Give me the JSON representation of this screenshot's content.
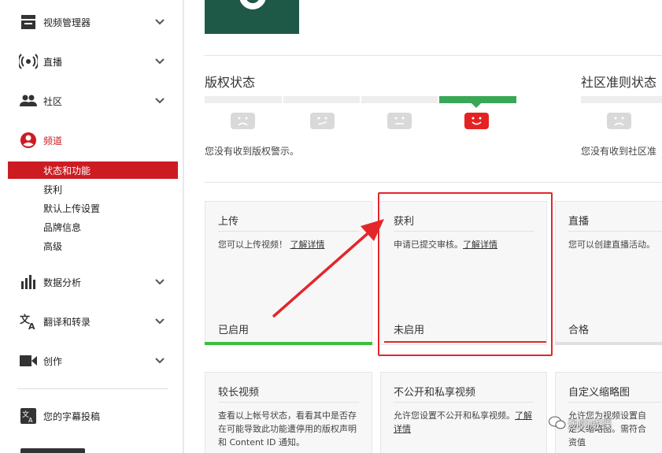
{
  "sidebar": {
    "items": [
      {
        "label": "视频管理器",
        "icon": "video-manager-icon"
      },
      {
        "label": "直播",
        "icon": "live-icon"
      },
      {
        "label": "社区",
        "icon": "community-icon"
      },
      {
        "label": "频道",
        "icon": "channel-icon"
      },
      {
        "label": "数据分析",
        "icon": "analytics-icon"
      },
      {
        "label": "翻译和转录",
        "icon": "translate-icon"
      },
      {
        "label": "创作",
        "icon": "create-icon"
      }
    ],
    "channel_subitems": [
      "状态和功能",
      "获利",
      "默认上传设置",
      "品牌信息",
      "高级"
    ],
    "active_subitem": "状态和功能",
    "subtitles": {
      "label": "您的字幕投稿",
      "icon": "subtitles-icon"
    }
  },
  "copyright": {
    "title": "版权状态",
    "text": "您没有收到版权警示。",
    "level": 4,
    "levels_total": 4
  },
  "community": {
    "title": "社区准则状态",
    "text": "您没有收到社区准"
  },
  "cards_row1": [
    {
      "title": "上传",
      "desc": "您可以上传视频！",
      "link": "了解详情",
      "status": "已启用",
      "bar": "green"
    },
    {
      "title": "获利",
      "desc": "申请已提交审核。",
      "link": "了解详情",
      "status": "未启用",
      "bar": "red"
    },
    {
      "title": "直播",
      "desc": "您可以创建直播活动。",
      "link": "",
      "status": "合格",
      "bar": "gray"
    }
  ],
  "cards_row2": [
    {
      "title": "较长视频",
      "desc": "查看以上帐号状态，看看其中是否存在可能导致此功能遭停用的版权声明和 Content ID 通知。"
    },
    {
      "title": "不公开和私享视频",
      "desc": "允许您设置不公开和私享视频。",
      "link": "了解详情"
    },
    {
      "title": "自定义缩略图",
      "desc": "允许您为视频设置自定义缩略图。需符合资值"
    }
  ],
  "watermark": "汤阳威课",
  "colors": {
    "accent_red": "#cc1c22",
    "green": "#3aa757",
    "annotation": "#e3262a"
  }
}
